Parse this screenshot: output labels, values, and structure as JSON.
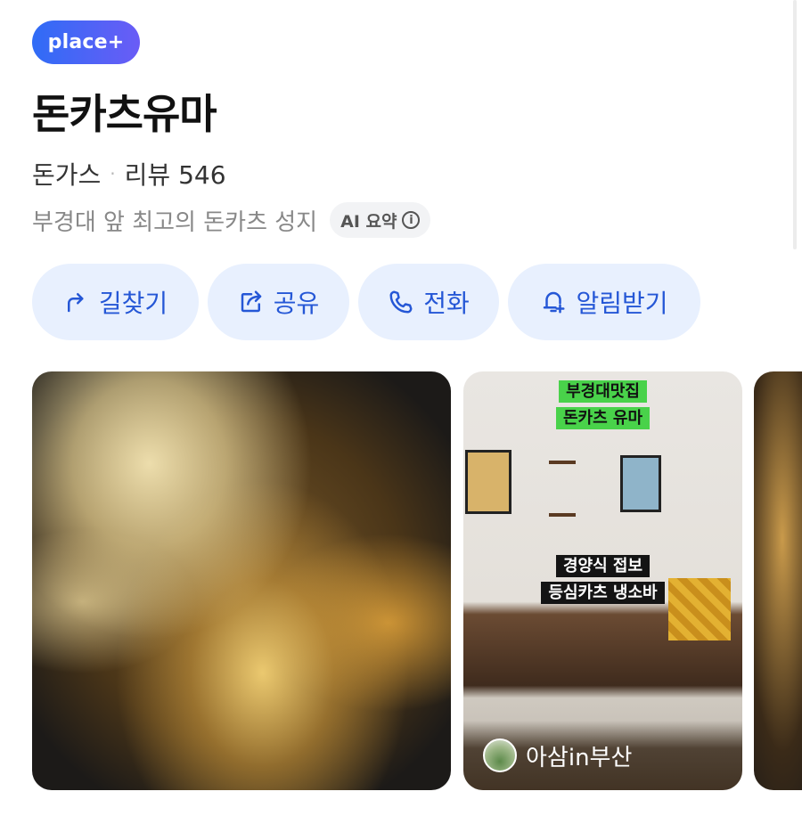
{
  "badge": {
    "label": "place+"
  },
  "place": {
    "name": "돈카츠유마",
    "category": "돈가스",
    "separator": "·",
    "review_label": "리뷰",
    "review_count": "546",
    "summary": "부경대 앞 최고의 돈카츠 성지",
    "ai_summary_label": "AI 요약",
    "info_glyph": "i"
  },
  "actions": [
    {
      "label": "길찾기",
      "icon": "directions-icon"
    },
    {
      "label": "공유",
      "icon": "share-icon"
    },
    {
      "label": "전화",
      "icon": "phone-icon"
    },
    {
      "label": "알림받기",
      "icon": "bell-add-icon"
    }
  ],
  "photos": {
    "shop": {
      "caption_top_1": "부경대맛집",
      "caption_top_2": "돈카츠 유마",
      "caption_mid_1": "경양식 접보",
      "caption_mid_2": "등심카츠 냉소바",
      "author": "아삼in부산"
    }
  },
  "colors": {
    "accent": "#2557d6",
    "action_bg": "#e8f0fe",
    "badge_gradient_start": "#2f6cf6",
    "badge_gradient_end": "#6a5cf6"
  }
}
